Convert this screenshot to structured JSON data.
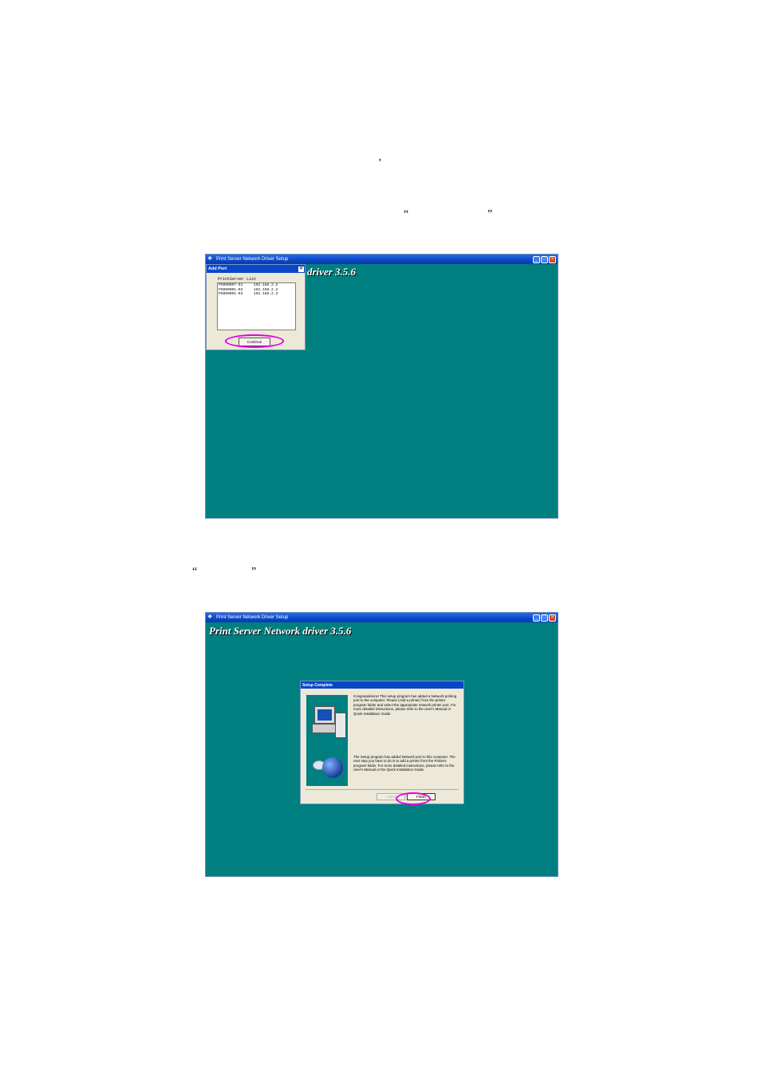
{
  "doc": {
    "quote1": "’",
    "quote2_open": "“",
    "quote2_close": "”",
    "quote3_open": "“",
    "quote3_close": "”"
  },
  "screenshot1": {
    "window_title": "Print Server Network Driver Setup",
    "banner_partial": "driver 3.5.6",
    "dialog": {
      "title": "Add Port",
      "list_label": "PrintServer List",
      "rows": [
        {
          "name": "PS000007-01",
          "ip": "192.168.2.2"
        },
        {
          "name": "PS000001-02",
          "ip": "192.168.2.2"
        },
        {
          "name": "PS000001-03",
          "ip": "192.168.2.2"
        }
      ],
      "button": "Continue"
    }
  },
  "screenshot2": {
    "window_title": "Print Server Network Driver Setup",
    "banner": "Print Server Network driver 3.5.6",
    "dialog": {
      "title": "Setup Complete",
      "text1": "Congratulations! This setup program has added a Network printing port to the computer. Please (Add a printer) from the printer program folder and select the appropriate network printer port. For more detailed instructions, please refer to the User's Manual or Quick Installation Guide.",
      "text2": "The Setup program has added Network port to this computer. The next step you have to do is to add a printer from the Printers program folder. For more detailed instructions, please refer to the User's Manual or the Quick Installation Guide.",
      "back_button": "< Back",
      "finish_button": "Finish"
    }
  },
  "colors": {
    "desktop_teal": "#007f80",
    "highlight_ring": "#e100e1",
    "titlebar_blue": "#0a46c8"
  }
}
